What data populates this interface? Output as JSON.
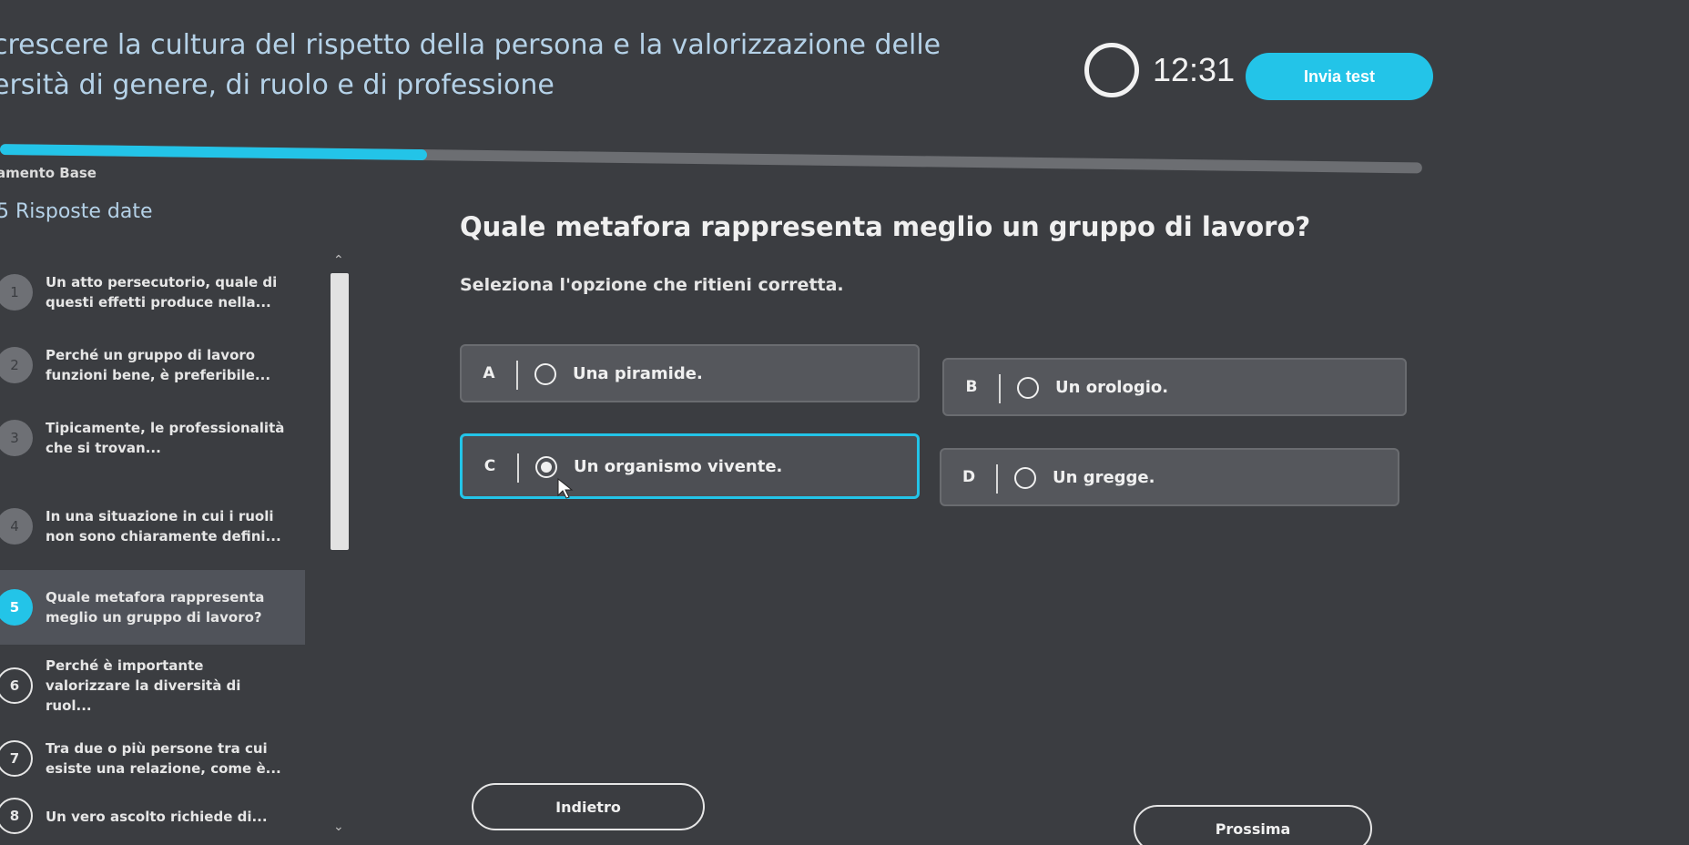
{
  "header": {
    "title_line1": "crescere la cultura del rispetto della persona e la valorizzazione delle",
    "title_line2": "ersità di genere, di ruolo e di professione",
    "timer": "12:31",
    "send_label": "Invia test"
  },
  "progress": {
    "fraction": 0.3,
    "course_label": "amento Base"
  },
  "sidebar": {
    "answered_count": "5 Risposte date",
    "items": [
      {
        "num": "1",
        "text": "Un atto persecutorio, quale di questi effetti produce nella...",
        "state": "answered"
      },
      {
        "num": "2",
        "text": "Perché un gruppo di lavoro funzioni bene, è preferibile...",
        "state": "answered"
      },
      {
        "num": "3",
        "text": "Tipicamente, le professionalità che si trovan...",
        "state": "answered"
      },
      {
        "num": "4",
        "text": "In una situazione in cui i ruoli non sono chiaramente defini...",
        "state": "answered"
      },
      {
        "num": "5",
        "text": "Quale metafora rappresenta meglio un gruppo di lavoro?",
        "state": "current"
      },
      {
        "num": "6",
        "text": "Perché è importante valorizzare la diversità di ruol...",
        "state": "unanswered"
      },
      {
        "num": "7",
        "text": "Tra due o più persone tra cui esiste una relazione, come è...",
        "state": "unanswered"
      },
      {
        "num": "8",
        "text": "Un vero ascolto richiede di...",
        "state": "unanswered"
      }
    ]
  },
  "question": {
    "title": "Quale metafora rappresenta meglio un gruppo di lavoro?",
    "hint": "Seleziona l'opzione che ritieni corretta.",
    "options": [
      {
        "letter": "A",
        "label": "Una piramide.",
        "selected": false
      },
      {
        "letter": "B",
        "label": "Un orologio.",
        "selected": false
      },
      {
        "letter": "C",
        "label": "Un organismo vivente.",
        "selected": true
      },
      {
        "letter": "D",
        "label": "Un gregge.",
        "selected": false
      }
    ]
  },
  "nav": {
    "back_label": "Indietro",
    "next_label": "Prossima"
  },
  "colors": {
    "accent": "#23c4e8",
    "background": "#3b3d41"
  }
}
